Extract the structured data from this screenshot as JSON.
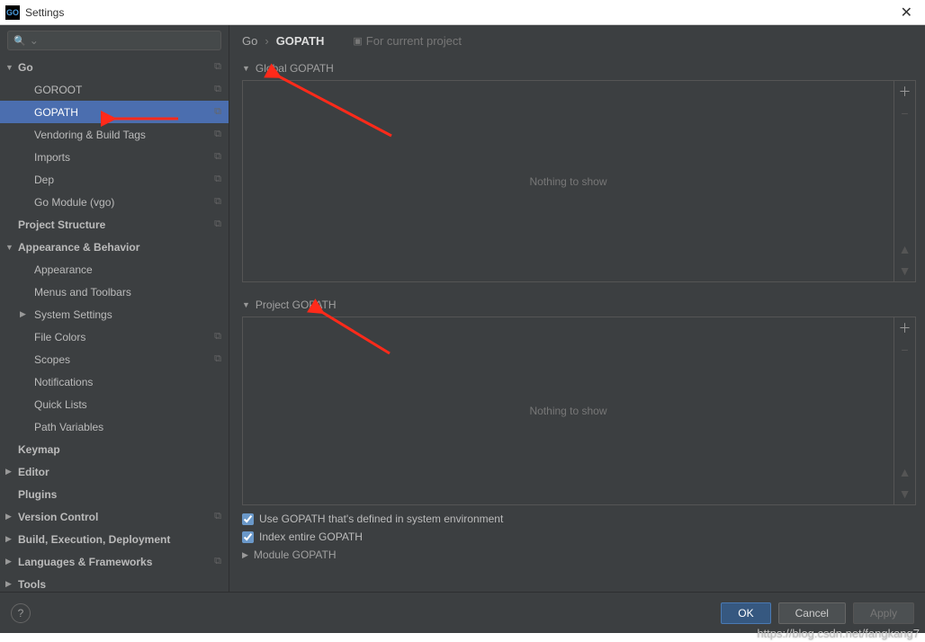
{
  "window": {
    "title": "Settings",
    "close": "✕"
  },
  "search": {
    "placeholder": ""
  },
  "sidebar": {
    "items": [
      {
        "label": "Go",
        "level": 0,
        "expanded": true,
        "copy": true
      },
      {
        "label": "GOROOT",
        "level": 1,
        "copy": true
      },
      {
        "label": "GOPATH",
        "level": 1,
        "copy": true,
        "selected": true
      },
      {
        "label": "Vendoring & Build Tags",
        "level": 1,
        "copy": true
      },
      {
        "label": "Imports",
        "level": 1,
        "copy": true
      },
      {
        "label": "Dep",
        "level": 1,
        "copy": true
      },
      {
        "label": "Go Module (vgo)",
        "level": 1,
        "copy": true
      },
      {
        "label": "Project Structure",
        "level": 0,
        "noarrow": true,
        "copy": true
      },
      {
        "label": "Appearance & Behavior",
        "level": 0,
        "expanded": true
      },
      {
        "label": "Appearance",
        "level": 1
      },
      {
        "label": "Menus and Toolbars",
        "level": 1
      },
      {
        "label": "System Settings",
        "level": 1,
        "haschild": true,
        "expanded": false
      },
      {
        "label": "File Colors",
        "level": 1,
        "copy": true
      },
      {
        "label": "Scopes",
        "level": 1,
        "copy": true
      },
      {
        "label": "Notifications",
        "level": 1
      },
      {
        "label": "Quick Lists",
        "level": 1
      },
      {
        "label": "Path Variables",
        "level": 1
      },
      {
        "label": "Keymap",
        "level": 0,
        "noarrow": true
      },
      {
        "label": "Editor",
        "level": 0,
        "expanded": false
      },
      {
        "label": "Plugins",
        "level": 0,
        "noarrow": true
      },
      {
        "label": "Version Control",
        "level": 0,
        "expanded": false,
        "copy": true
      },
      {
        "label": "Build, Execution, Deployment",
        "level": 0,
        "expanded": false
      },
      {
        "label": "Languages & Frameworks",
        "level": 0,
        "expanded": false,
        "copy": true
      },
      {
        "label": "Tools",
        "level": 0,
        "expanded": false
      }
    ]
  },
  "breadcrumb": {
    "root": "Go",
    "current": "GOPATH",
    "hint": "For current project"
  },
  "sections": {
    "global": {
      "title": "Global GOPATH",
      "empty": "Nothing to show"
    },
    "project": {
      "title": "Project GOPATH",
      "empty": "Nothing to show"
    },
    "module": {
      "title": "Module GOPATH"
    }
  },
  "options": {
    "use_system": {
      "label": "Use GOPATH that's defined in system environment",
      "checked": true
    },
    "index_entire": {
      "label": "Index entire GOPATH",
      "checked": true
    }
  },
  "footer": {
    "help": "?",
    "ok": "OK",
    "cancel": "Cancel",
    "apply": "Apply"
  },
  "watermark": "https://blog.csdn.net/fangkang7"
}
